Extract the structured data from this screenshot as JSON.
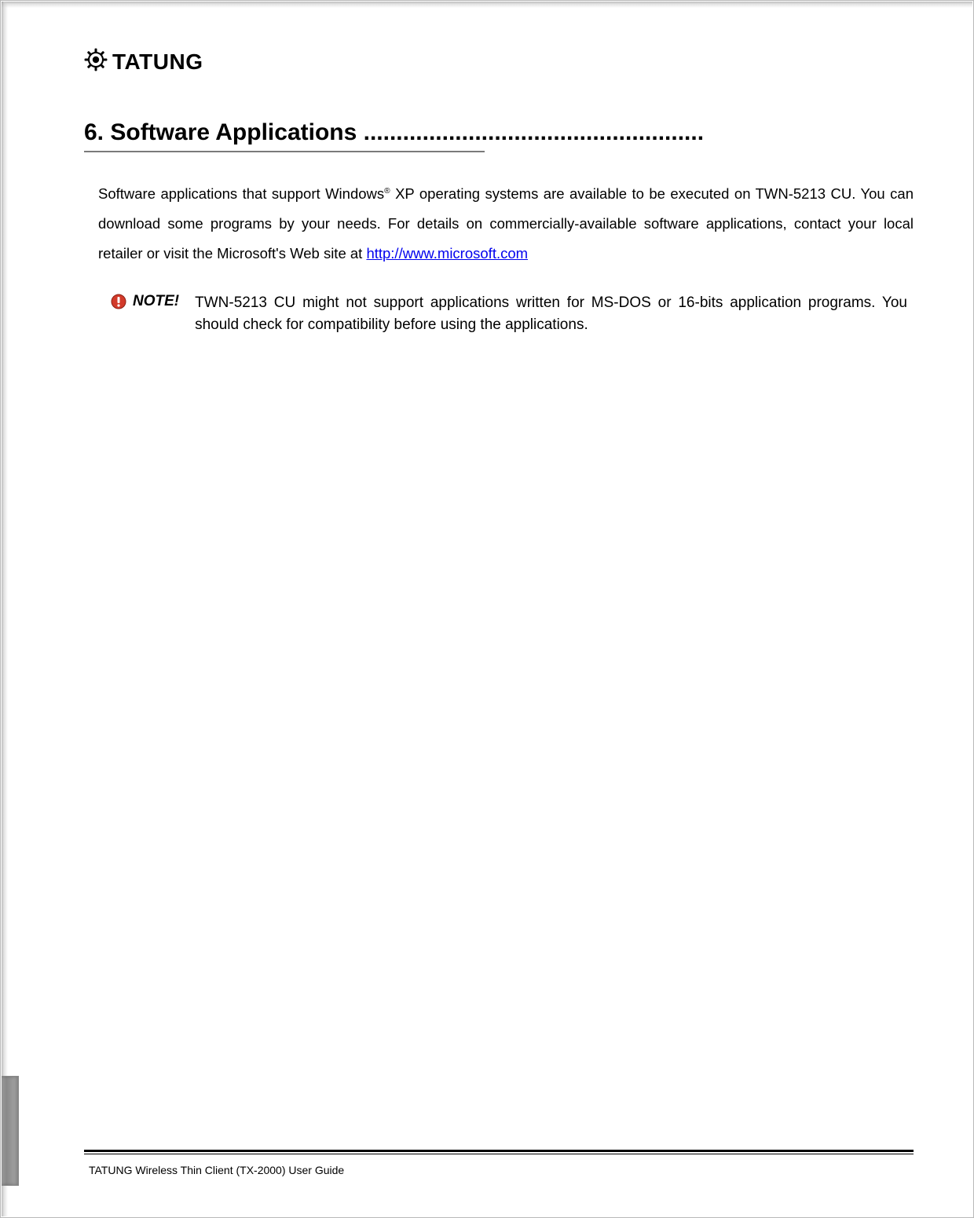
{
  "brand": {
    "name": "TATUNG"
  },
  "heading": {
    "text": "6. Software Applications ...................................................."
  },
  "paragraph": {
    "pre": "Software applications that support Windows",
    "sup": "®",
    "mid": " XP operating systems are available to be executed on TWN-5213 CU. You can download some programs by your needs. For details on commercially-available software applications, contact your local retailer or visit the Microsoft's Web site at ",
    "link_text": "http://www.microsoft.com",
    "link_href": "http://www.microsoft.com"
  },
  "note": {
    "label": "NOTE!",
    "body": "TWN-5213 CU might not support applications written for MS-DOS or 16-bits application programs. You should check for compatibility before using the applications."
  },
  "footer": {
    "text": "TATUNG Wireless Thin Client (TX-2000) User Guide"
  }
}
